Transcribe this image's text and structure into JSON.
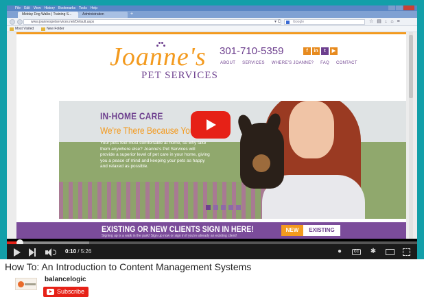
{
  "browser": {
    "menu": [
      "File",
      "Edit",
      "View",
      "History",
      "Bookmarks",
      "Tools",
      "Help"
    ],
    "tabs": [
      {
        "label": "Midday Dog Walks | Training S...",
        "active": true
      },
      {
        "label": "Administration",
        "active": false
      }
    ],
    "url": "www.joannespetservices.net/Default.aspx",
    "search_placeholder": "Google",
    "bookmarks": [
      "Most Visited",
      "New Folder"
    ]
  },
  "site": {
    "logo_name": "Joanne's",
    "logo_sub": "PET SERVICES",
    "phone": "301-710-5359",
    "social_icons": [
      "facebook-icon",
      "linkedin-icon",
      "twitter-icon",
      "youtube-icon"
    ],
    "nav": [
      "ABOUT",
      "SERVICES",
      "WHERE'S JOANNE?",
      "FAQ",
      "CONTACT"
    ],
    "hero_title": "IN-HOME CARE",
    "hero_subtitle": "We're There Because You C",
    "hero_body": "Your pets feel most comfortable at home, so why take them anywhere else? Joanne's Pet Services will provide a superior level of pet care in your home, giving you a peace of mind and keeping your pets as happy and relaxed as possible.",
    "slides": 5,
    "active_slide": 1,
    "banner_title": "EXISTING OR NEW CLIENTS SIGN IN HERE!",
    "banner_sub": "Signing up is a walk in the park! Sign up now or sign in if you're already an existing client!",
    "btn_new": "NEW",
    "btn_existing": "EXISTING"
  },
  "player": {
    "current_time": "0:10",
    "duration": "5:26",
    "progress_fraction": 0.031,
    "buffered_fraction": 0.2,
    "colors": {
      "accent": "#e62117",
      "brand_orange": "#f39a1e",
      "brand_purple": "#6d3f8e",
      "backdrop": "#139fa9"
    }
  },
  "video": {
    "title": "How To: An Introduction to Content Management Systems",
    "channel": "balancelogic",
    "subscribe_label": "Subscribe"
  }
}
